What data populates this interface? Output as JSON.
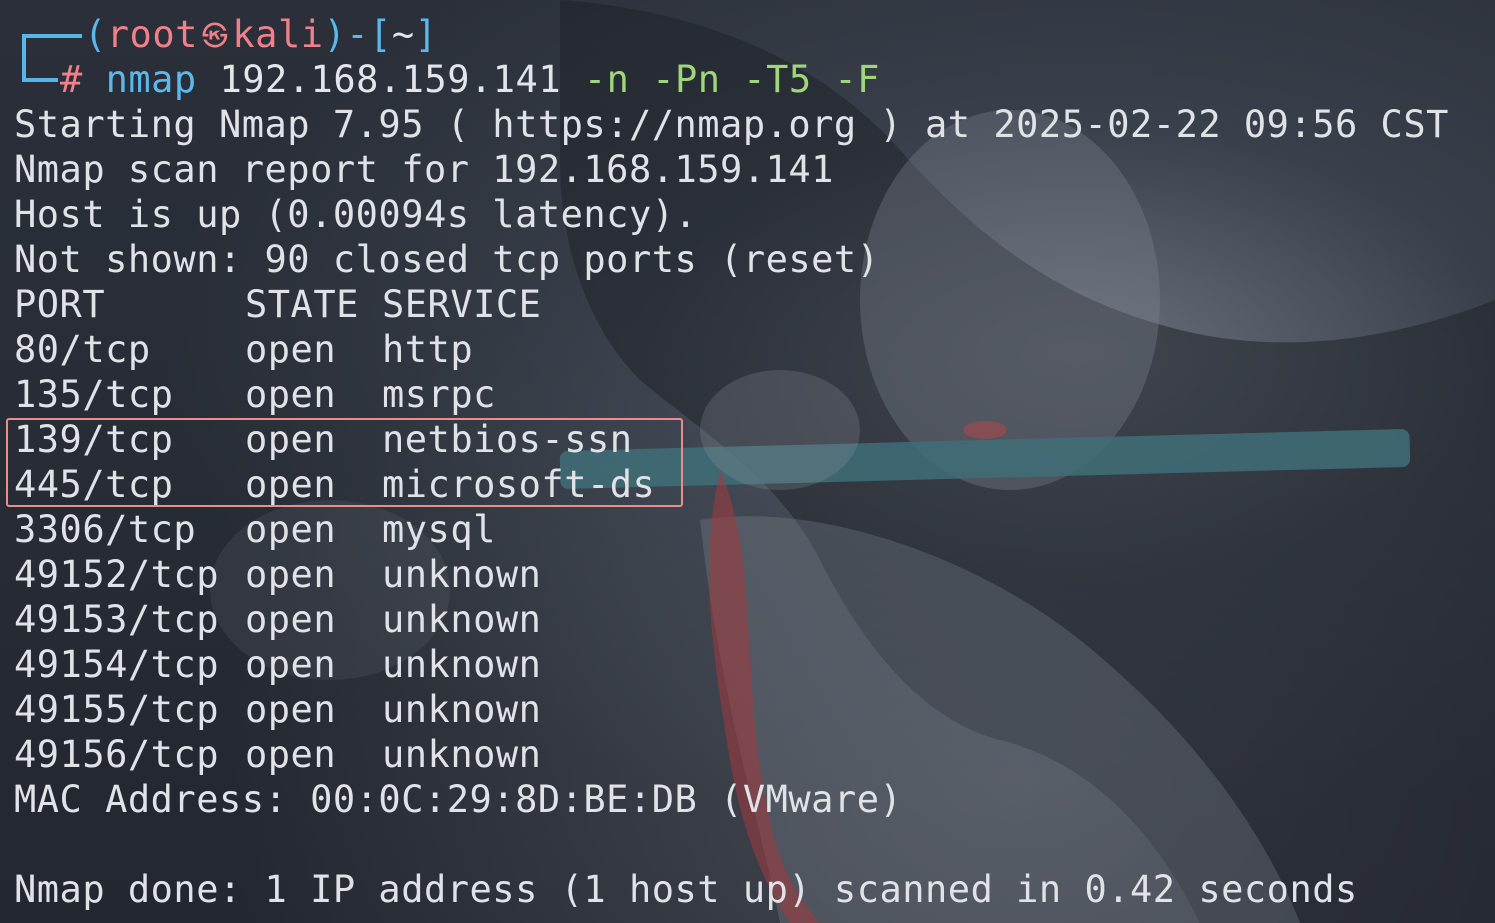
{
  "prompt": {
    "open_paren": "(",
    "user": "root",
    "symbol": "㉿",
    "host": "kali",
    "close_paren": ")-[",
    "path": "~",
    "close_bracket": "]",
    "hash": "#",
    "command": "nmap",
    "target": "192.168.159.141",
    "flags": "-n -Pn -T5 -F"
  },
  "output": {
    "starting": "Starting Nmap 7.95 ( https://nmap.org ) at 2025-02-22 09:56 CST",
    "report": "Nmap scan report for 192.168.159.141",
    "host_up": "Host is up (0.00094s latency).",
    "not_shown": "Not shown: 90 closed tcp ports (reset)",
    "headers": {
      "port": "PORT",
      "state": "STATE",
      "service": "SERVICE"
    },
    "ports": [
      {
        "port": "80/tcp",
        "state": "open",
        "service": "http"
      },
      {
        "port": "135/tcp",
        "state": "open",
        "service": "msrpc"
      },
      {
        "port": "139/tcp",
        "state": "open",
        "service": "netbios-ssn"
      },
      {
        "port": "445/tcp",
        "state": "open",
        "service": "microsoft-ds"
      },
      {
        "port": "3306/tcp",
        "state": "open",
        "service": "mysql"
      },
      {
        "port": "49152/tcp",
        "state": "open",
        "service": "unknown"
      },
      {
        "port": "49153/tcp",
        "state": "open",
        "service": "unknown"
      },
      {
        "port": "49154/tcp",
        "state": "open",
        "service": "unknown"
      },
      {
        "port": "49155/tcp",
        "state": "open",
        "service": "unknown"
      },
      {
        "port": "49156/tcp",
        "state": "open",
        "service": "unknown"
      }
    ],
    "mac": "MAC Address: 00:0C:29:8D:BE:DB (VMware)",
    "done": "Nmap done: 1 IP address (1 host up) scanned in 0.42 seconds"
  },
  "colors": {
    "prompt_blue": "#5bb8ea",
    "prompt_red": "#f0808a",
    "flag_green": "#9ed77a",
    "text": "#dfe2e7",
    "highlight": "#e98d8d"
  }
}
